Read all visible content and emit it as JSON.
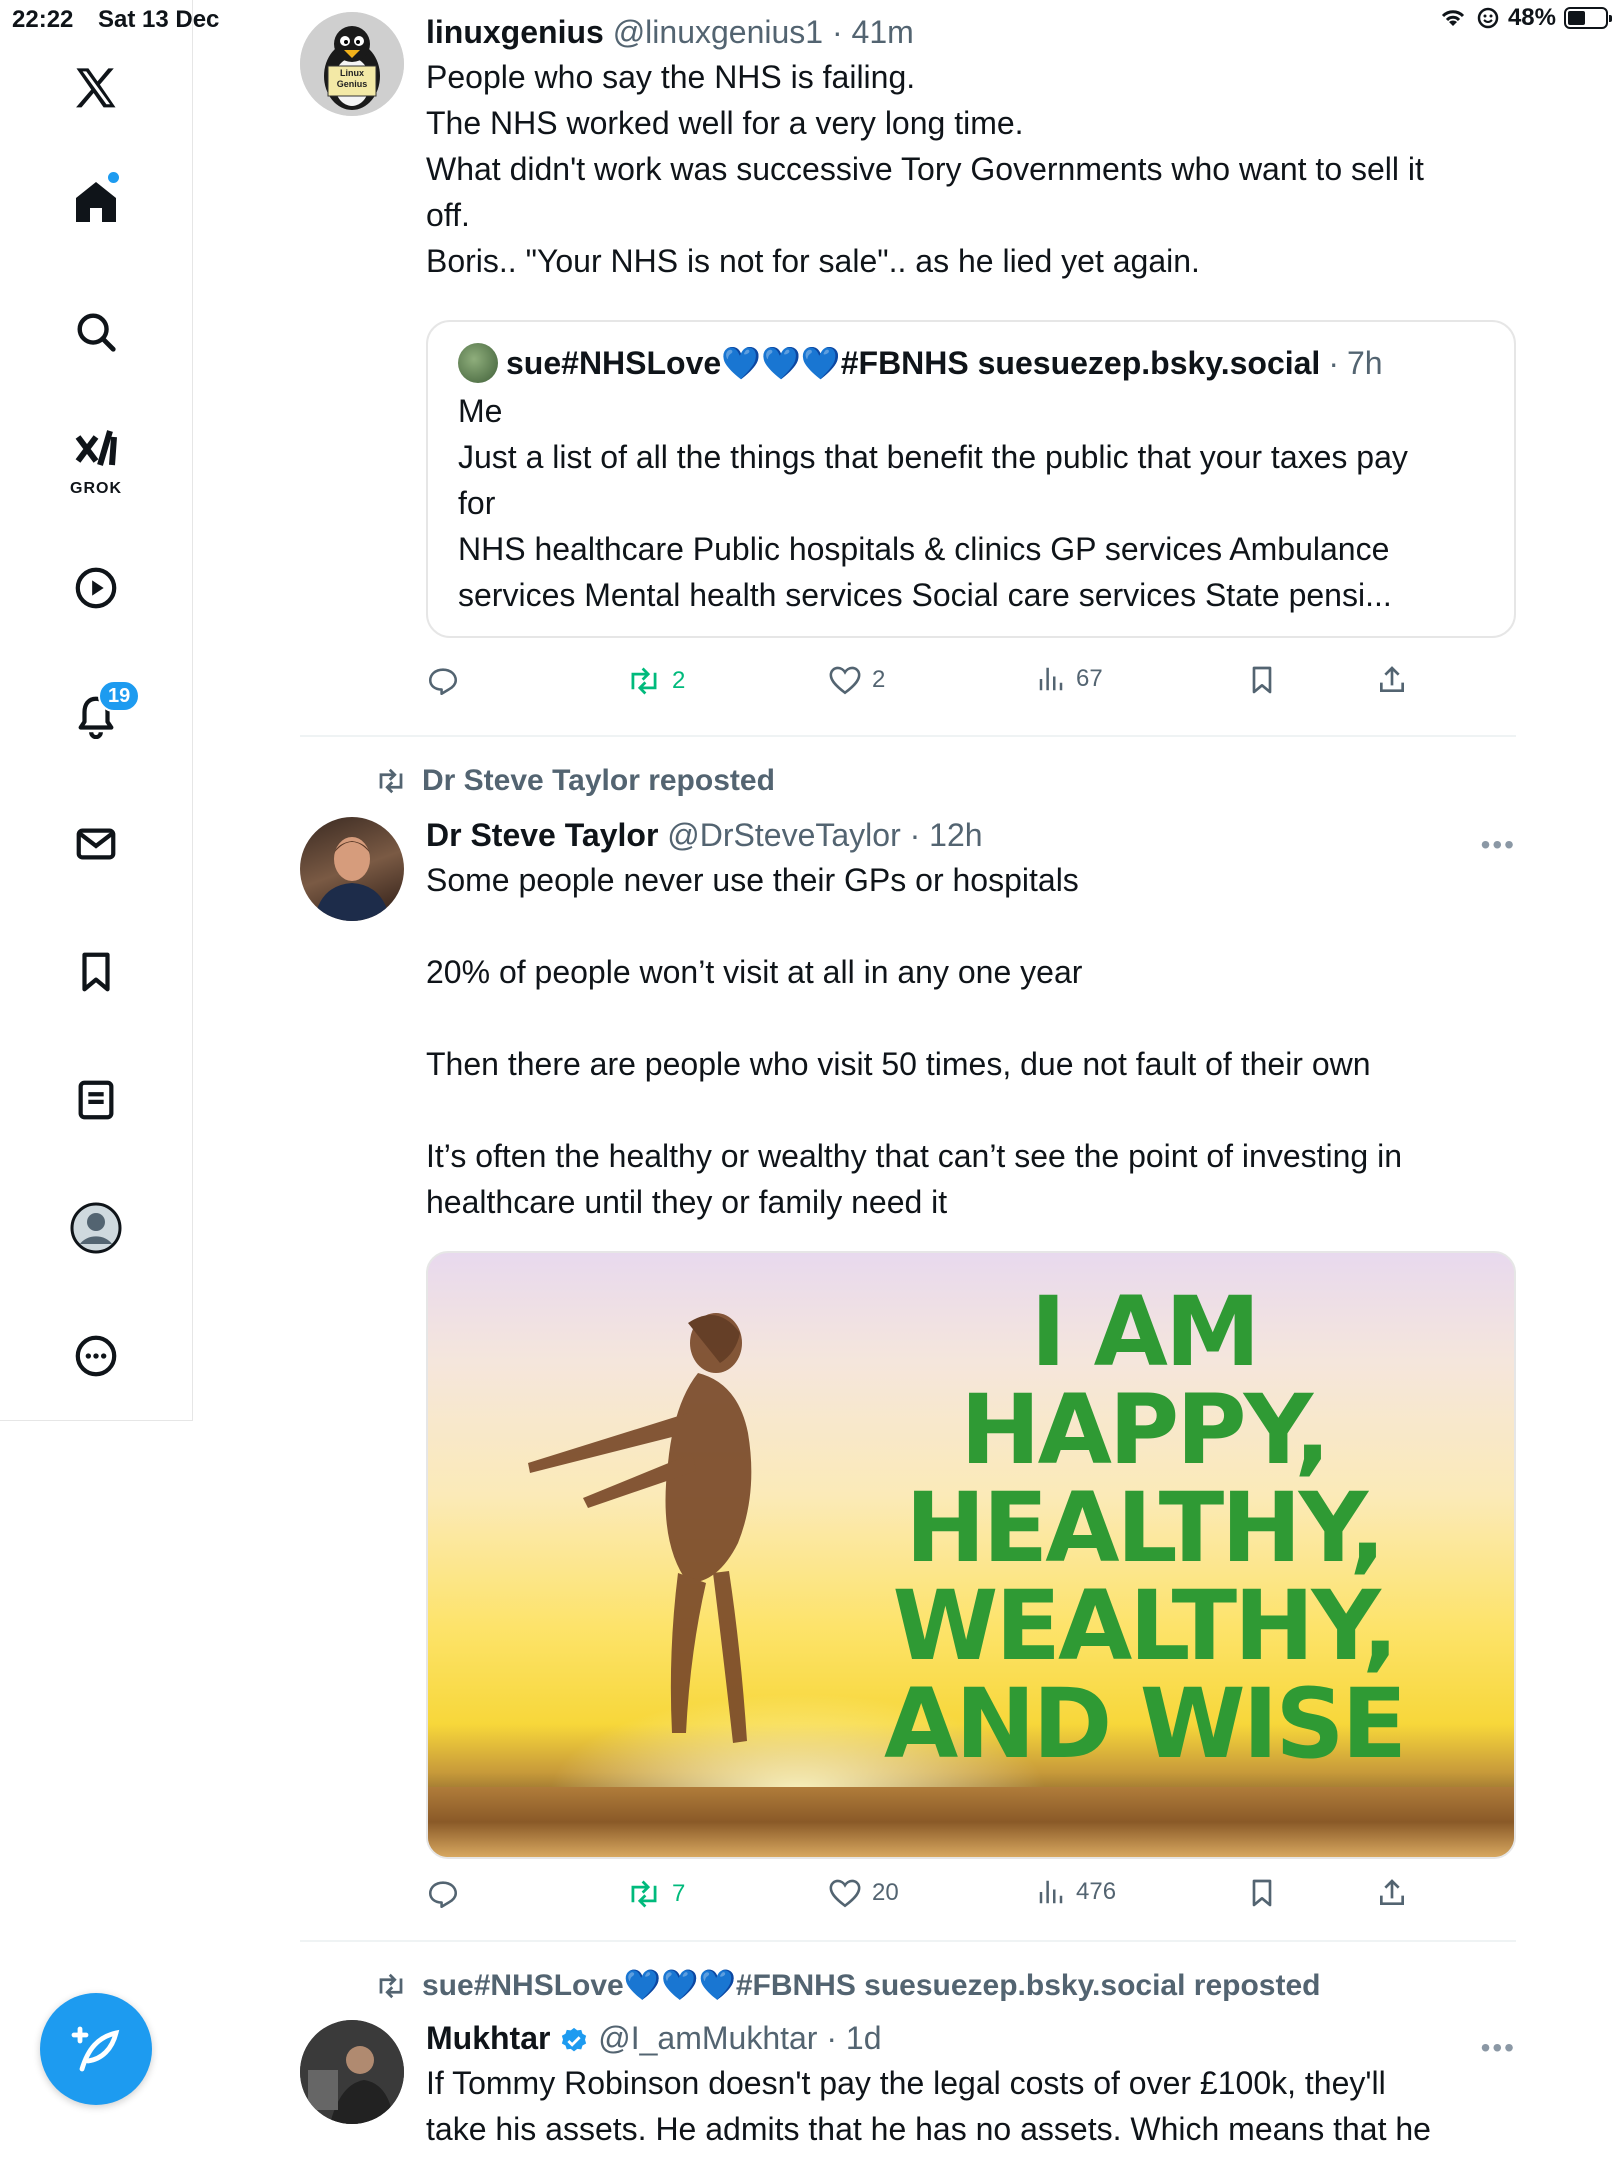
{
  "status_bar": {
    "time": "22:22",
    "date": "Sat 13 Dec",
    "battery": "48%",
    "battery_level": 0.48
  },
  "sidebar": {
    "grok_label": "GROK",
    "notifications_count": "19",
    "icons": [
      "x-logo-icon",
      "home-icon",
      "search-icon",
      "grok-icon",
      "video-icon",
      "notifications-icon",
      "messages-icon",
      "bookmarks-icon",
      "lists-icon",
      "profile-icon",
      "more-icon"
    ]
  },
  "tweets": [
    {
      "name": "linuxgenius",
      "handle": "@linuxgenius1",
      "time": "41m",
      "avatar_text": "Linux Genius",
      "lines": [
        "People who say the NHS is failing.",
        "The NHS worked well for a very long time.",
        "What didn't work was successive Tory Governments who want to sell it",
        "off.",
        "Boris.. \"Your NHS is not for sale\".. as he lied yet again."
      ],
      "quote": {
        "name_start": "sue#NHSLove",
        "hearts": "💙💙💙",
        "name_end": "#FBNHS suesuezep.bsky.social",
        "time": "7h",
        "lines": [
          "Me",
          "Just a list of all the things that benefit the public that your taxes pay",
          "for",
          "NHS healthcare  Public hospitals & clinics  GP services  Ambulance",
          "services  Mental health services  Social care services  State pensi..."
        ]
      },
      "reposts": "2",
      "likes": "2",
      "views": "67"
    },
    {
      "repost_by": "Dr Steve Taylor reposted",
      "name": "Dr Steve Taylor",
      "handle": "@DrSteveTaylor",
      "time": "12h",
      "lines": [
        "Some people never use their GPs or hospitals",
        "",
        "20% of people won’t visit at all in any one year",
        "",
        "Then there are people who visit 50 times, due not fault of their own",
        "",
        "It’s often the healthy or wealthy that can’t see the point of investing in",
        "healthcare until they or family need it"
      ],
      "image_text": [
        "I AM HAPPY,",
        "HEALTHY,",
        "WEALTHY,",
        "AND WISE"
      ],
      "reposts": "7",
      "likes": "20",
      "views": "476"
    },
    {
      "repost_start": "sue#NHSLove",
      "repost_hearts": "💙💙💙",
      "repost_end": "#FBNHS suesuezep.bsky.social reposted",
      "name": "Mukhtar",
      "handle": "@I_amMukhtar",
      "time": "1d",
      "lines": [
        "If Tommy Robinson doesn't pay the legal costs of over £100k, they'll",
        "take his assets. He admits that he has no assets. Which means that he"
      ]
    }
  ],
  "colors": {
    "accent": "#1d9bf0",
    "repost_green": "#00ba7c",
    "secondary_text": "#536471",
    "image_text_green": "#2f9a34"
  }
}
